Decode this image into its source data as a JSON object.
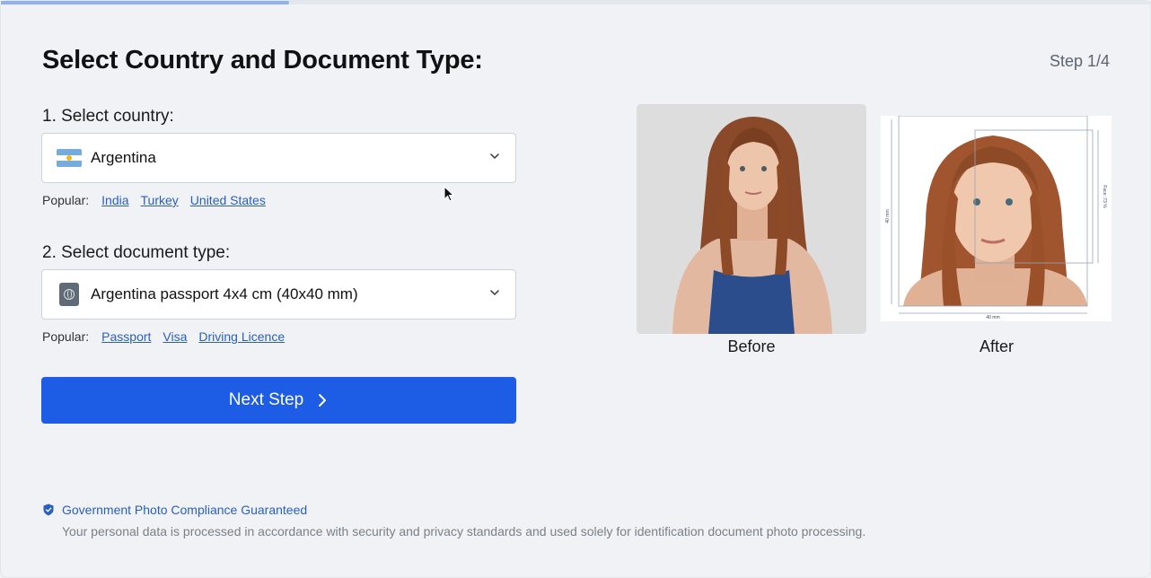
{
  "progress": {
    "fraction": 0.25
  },
  "header": {
    "title": "Select Country and Document Type:",
    "step": "Step 1/4"
  },
  "country": {
    "label": "1. Select country:",
    "selected": "Argentina",
    "flag_icon": "argentina-flag-icon",
    "popular_label": "Popular:",
    "popular": [
      "India",
      "Turkey",
      "United States"
    ]
  },
  "document": {
    "label": "2. Select document type:",
    "selected": "Argentina passport 4x4 cm (40x40 mm)",
    "icon": "passport-icon",
    "popular_label": "Popular:",
    "popular": [
      "Passport",
      "Visa",
      "Driving Licence"
    ]
  },
  "next_button": {
    "label": "Next Step",
    "icon": "chevron-right-icon"
  },
  "preview": {
    "before_caption": "Before",
    "after_caption": "After",
    "after_guides": {
      "height": "40 mm",
      "width": "40 mm",
      "face": "Face: 73 %"
    }
  },
  "footer": {
    "compliance": "Government Photo Compliance Guaranteed",
    "privacy": "Your personal data is processed in accordance with security and privacy standards and used solely for identification document photo processing."
  },
  "colors": {
    "accent": "#1d5ce5",
    "link": "#2a5fc0",
    "background": "#f0f2f5",
    "progress": "#8fb3ea"
  }
}
